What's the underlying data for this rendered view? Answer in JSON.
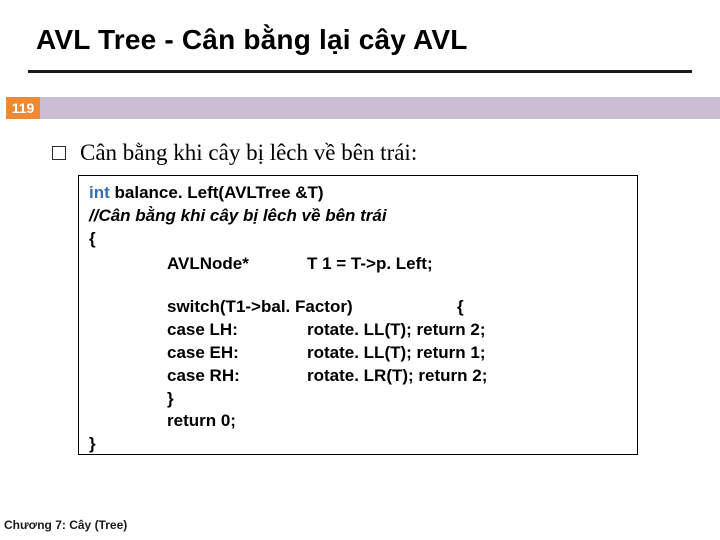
{
  "slide": {
    "title": "AVL Tree - Cân bằng lại cây AVL",
    "page_number": "119",
    "bullet": "Cân bằng khi cây bị lêch về bên trái:",
    "footer": "Chương 7: Cây (Tree)"
  },
  "code": {
    "sig_prefix": "int",
    "sig_rest": " balance. Left(AVLTree &T)",
    "comment": "//Cân bằng khi cây bị lêch về bên trái",
    "brace_open": "{",
    "decl_type": "AVLNode*",
    "decl_assign": "T 1 = T->p. Left;",
    "switch_head": "switch(T1->bal. Factor)",
    "switch_brace": "{",
    "case1_l": "case LH:",
    "case1_r": "rotate. LL(T); return 2;",
    "case2_l": "case EH:",
    "case2_r": "rotate. LL(T); return 1;",
    "case3_l": "case RH:",
    "case3_r": "rotate. LR(T); return 2;",
    "switch_close": "}",
    "ret": "return 0;",
    "brace_close": "}"
  }
}
